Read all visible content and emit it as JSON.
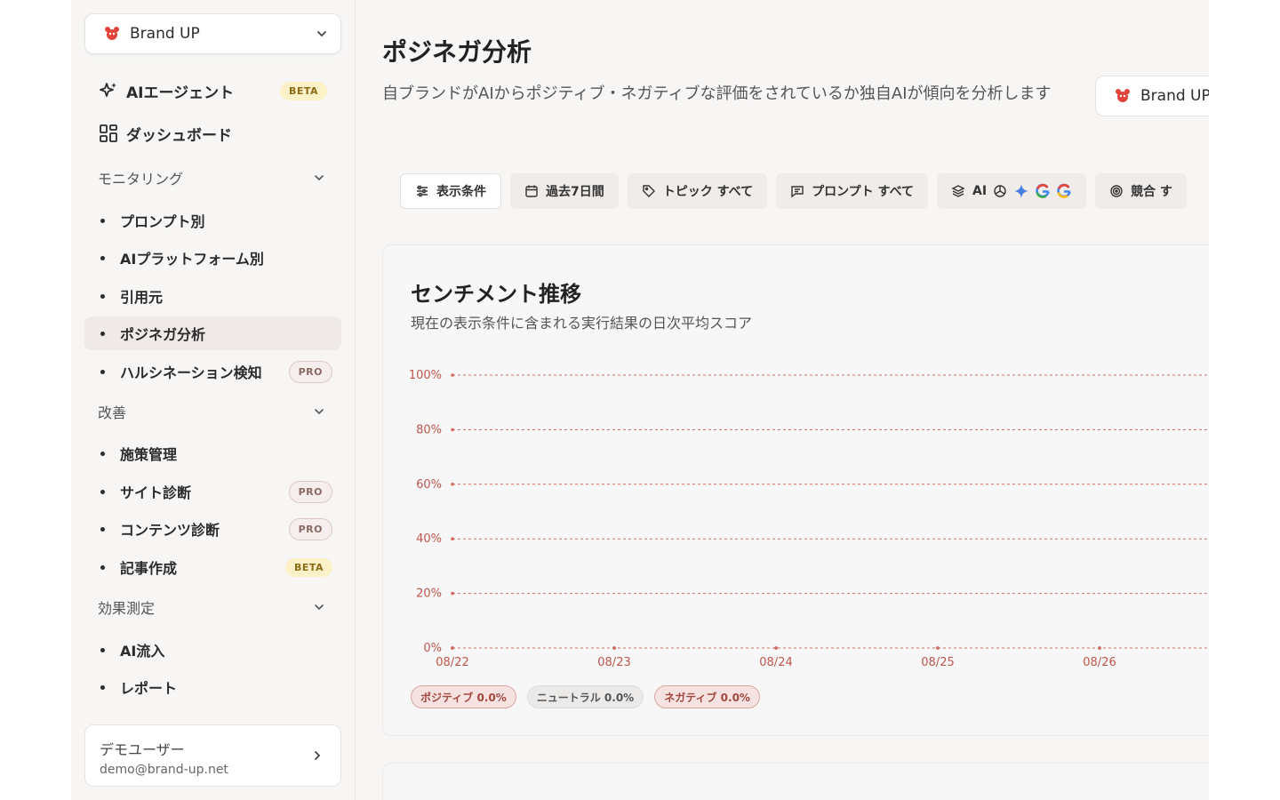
{
  "sidebar": {
    "brand": "Brand UP",
    "ai_agent": {
      "label": "AIエージェント",
      "badge": "BETA"
    },
    "dashboard": {
      "label": "ダッシュボード"
    },
    "sections": {
      "monitoring": {
        "label": "モニタリング",
        "items": [
          {
            "label": "プロンプト別"
          },
          {
            "label": "AIプラットフォーム別"
          },
          {
            "label": "引用元"
          },
          {
            "label": "ポジネガ分析"
          },
          {
            "label": "ハルシネーション検知",
            "badge": "PRO"
          }
        ]
      },
      "improve": {
        "label": "改善",
        "items": [
          {
            "label": "施策管理"
          },
          {
            "label": "サイト診断",
            "badge": "PRO"
          },
          {
            "label": "コンテンツ診断",
            "badge": "PRO"
          },
          {
            "label": "記事作成",
            "badge": "BETA"
          }
        ]
      },
      "measure": {
        "label": "効果測定",
        "items": [
          {
            "label": "AI流入"
          },
          {
            "label": "レポート"
          }
        ]
      }
    },
    "user": {
      "name": "デモユーザー",
      "email": "demo@brand-up.net"
    }
  },
  "main": {
    "title": "ポジネガ分析",
    "description": "自ブランドがAIからポジティブ・ネガティブな評価をされているか独自AIが傾向を分析します",
    "brand_button": "Brand UP",
    "filters": {
      "conditions": "表示条件",
      "period": "過去7日間",
      "topic": "トピック すべて",
      "prompt": "プロンプト すべて",
      "ai": "AI",
      "competitor": "競合 す"
    },
    "card": {
      "title": "センチメント推移",
      "subtitle": "現在の表示条件に含まれる実行結果の日次平均スコア",
      "legend": {
        "positive": "ポジティブ 0.0%",
        "neutral": "ニュートラル 0.0%",
        "negative": "ネガティブ 0.0%"
      }
    }
  },
  "chart_data": {
    "type": "line",
    "title": "センチメント推移",
    "categories": [
      "08/22",
      "08/23",
      "08/24",
      "08/25",
      "08/26"
    ],
    "y_ticks": [
      "100%",
      "80%",
      "60%",
      "40%",
      "20%",
      "0%"
    ],
    "ylim": [
      0,
      100
    ],
    "grid": true,
    "series": [
      {
        "name": "ポジティブ",
        "values": [
          0,
          0,
          0,
          0,
          0
        ]
      },
      {
        "name": "ニュートラル",
        "values": [
          0,
          0,
          0,
          0,
          0
        ]
      },
      {
        "name": "ネガティブ",
        "values": [
          0,
          0,
          0,
          0,
          0
        ]
      }
    ],
    "colors": {
      "grid": "#cf6b63",
      "tick": "#c0564d"
    }
  }
}
